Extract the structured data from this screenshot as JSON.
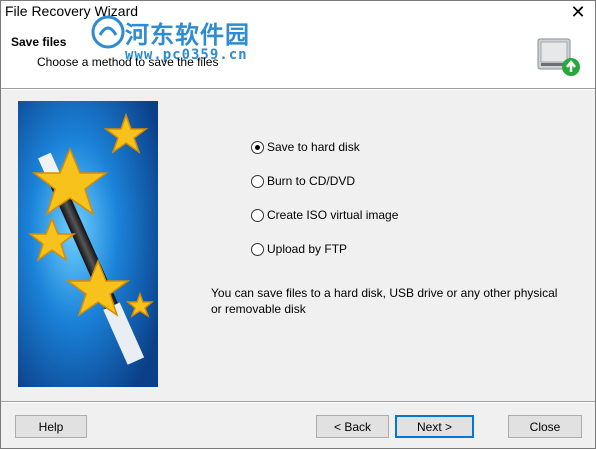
{
  "window": {
    "title": "File Recovery Wizard",
    "close_glyph": "✕"
  },
  "header": {
    "title": "Save files",
    "subtitle": "Choose a method to save the files",
    "icon": "hard-disk-icon"
  },
  "watermark": {
    "line1": "河东软件园",
    "line2": "www.pc0359.cn"
  },
  "options": [
    {
      "label": "Save to hard disk",
      "checked": true
    },
    {
      "label": "Burn to CD/DVD",
      "checked": false
    },
    {
      "label": "Create ISO virtual image",
      "checked": false
    },
    {
      "label": "Upload by FTP",
      "checked": false
    }
  ],
  "description": "You can save files to a hard disk, USB drive or any other physical or removable disk",
  "buttons": {
    "help": "Help",
    "back": "< Back",
    "next": "Next >",
    "close": "Close"
  },
  "colors": {
    "accent": "#0078d7",
    "watermark": "#2f8bd2",
    "art_blue": "#1b83d9",
    "star": "#f7c21b"
  }
}
